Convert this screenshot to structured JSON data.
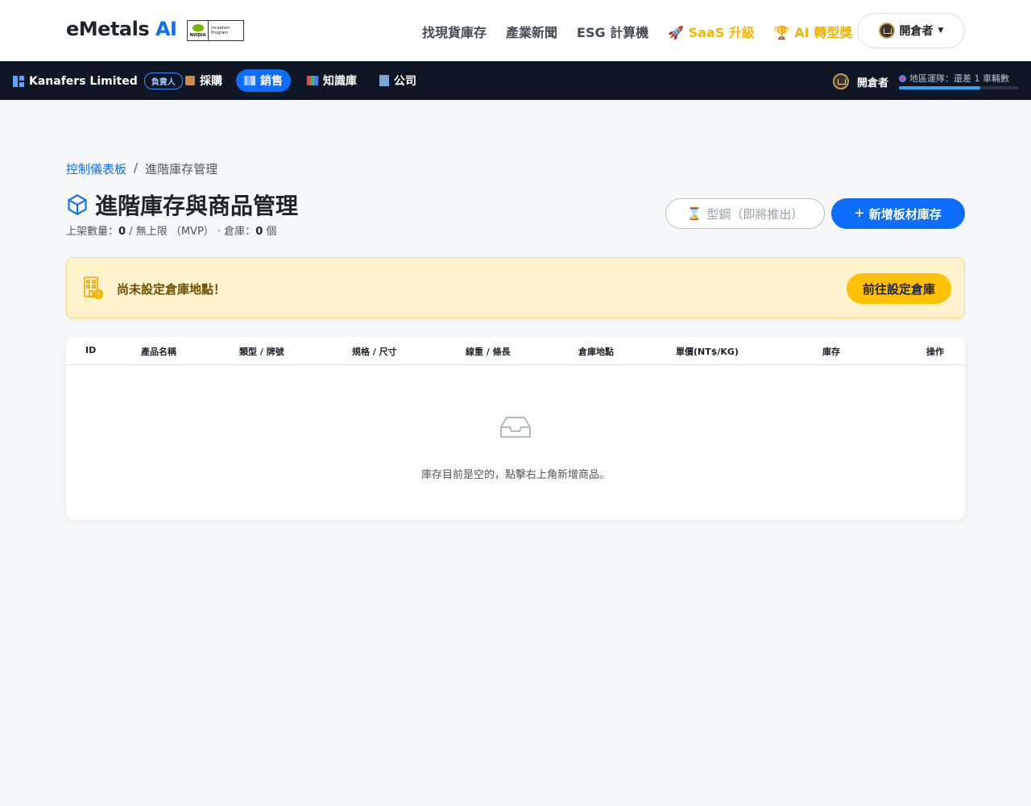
{
  "header": {
    "brand_main": "eMetals",
    "brand_ai": "AI",
    "nvidia_word": "NVIDIA",
    "nvidia_program": "Inception Program",
    "nav": [
      "找現貨庫存",
      "產業新聞",
      "ESG 計算機"
    ],
    "saas_label": "SaaS 升級",
    "award_label": "AI 轉型獎",
    "user_label": "開倉者"
  },
  "subnav": {
    "company": "Kanafers Limited",
    "role": "負責人",
    "items": [
      {
        "label": "採購",
        "icon": "box-icon",
        "active": false
      },
      {
        "label": "銷售",
        "icon": "factory-icon",
        "active": true
      },
      {
        "label": "知識庫",
        "icon": "books-icon",
        "active": false
      },
      {
        "label": "公司",
        "icon": "office-building-icon",
        "active": false
      }
    ],
    "user_label": "開倉者",
    "region_text": "地區運隊：還差 1 車輛數",
    "region_progress": 0.68
  },
  "main": {
    "breadcrumb_link": "控制儀表板",
    "breadcrumb_sep": "/",
    "breadcrumb_current": "進階庫存管理",
    "title": "進階庫存與商品管理",
    "stats_prefix": "上架數量：",
    "stats_count": "0",
    "stats_middle": " / 無上限 （MVP） · 倉庫：",
    "stats_warehouse": "0",
    "stats_suffix": " 個",
    "btn_steel": "型鋼（即將推出）",
    "btn_add": "新增板材庫存",
    "alert_text": "尚未設定倉庫地點！",
    "alert_button": "前往設定倉庫",
    "columns": [
      "ID",
      "產品名稱",
      "類型 / 牌號",
      "規格 / 尺寸",
      "線重 / 條長",
      "倉庫地點",
      "單價(NT$/KG)",
      "庫存",
      "操作"
    ],
    "empty_text": "庫存目前是空的，點擊右上角新增商品。"
  },
  "colors": {
    "primary": "#0d6efd",
    "warning": "#ffc107",
    "alert_bg": "#fff3cd",
    "dark_nav": "#0f1624"
  }
}
